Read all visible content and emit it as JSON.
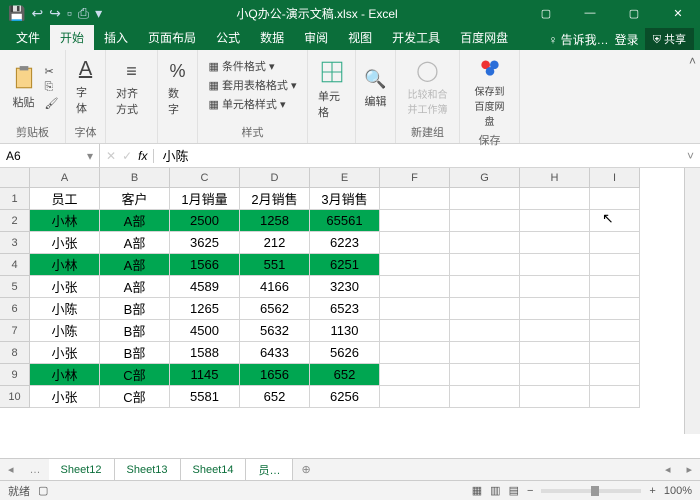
{
  "title": "小Q办公-演示文稿.xlsx - Excel",
  "tabs": [
    "文件",
    "开始",
    "插入",
    "页面布局",
    "公式",
    "数据",
    "审阅",
    "视图",
    "开发工具",
    "百度网盘"
  ],
  "active_tab": 1,
  "tell_me": "告诉我…",
  "login": "登录",
  "share": "共享",
  "ribbon": {
    "clipboard": {
      "paste": "粘贴",
      "label": "剪贴板"
    },
    "font": {
      "btn": "字体",
      "label": "字体"
    },
    "align": {
      "btn": "对齐方式",
      "label": ""
    },
    "number": {
      "btn": "数字",
      "label": ""
    },
    "styles": {
      "a": "条件格式",
      "b": "套用表格格式",
      "c": "单元格样式",
      "label": "样式"
    },
    "cells": {
      "btn": "单元格",
      "label": ""
    },
    "editing": {
      "btn": "编辑",
      "label": ""
    },
    "newgroup": {
      "btn": "比较和合并工作簿",
      "label": "新建组"
    },
    "save": {
      "btn": "保存到百度网盘",
      "label": "保存"
    }
  },
  "namebox": "A6",
  "fx": "fx",
  "formula_value": "小陈",
  "columns": [
    "A",
    "B",
    "C",
    "D",
    "E",
    "F",
    "G",
    "H",
    "I"
  ],
  "wclass": [
    "cw-a",
    "cw-b",
    "cw-c",
    "cw-d",
    "cw-e",
    "cw-f",
    "cw-g",
    "cw-h",
    "cw-i"
  ],
  "rownums": [
    "1",
    "2",
    "3",
    "4",
    "5",
    "6",
    "7",
    "8",
    "9",
    "10"
  ],
  "rows": [
    {
      "hl": false,
      "hdr": true,
      "cells": [
        "员工",
        "客户",
        "1月销量",
        "2月销售",
        "3月销售",
        "",
        "",
        "",
        ""
      ]
    },
    {
      "hl": true,
      "cells": [
        "小林",
        "A部",
        "2500",
        "1258",
        "65561",
        "",
        "",
        "",
        ""
      ]
    },
    {
      "hl": false,
      "cells": [
        "小张",
        "A部",
        "3625",
        "212",
        "6223",
        "",
        "",
        "",
        ""
      ]
    },
    {
      "hl": true,
      "cells": [
        "小林",
        "A部",
        "1566",
        "551",
        "6251",
        "",
        "",
        "",
        ""
      ]
    },
    {
      "hl": false,
      "cells": [
        "小张",
        "A部",
        "4589",
        "4166",
        "3230",
        "",
        "",
        "",
        ""
      ]
    },
    {
      "hl": false,
      "cells": [
        "小陈",
        "B部",
        "1265",
        "6562",
        "6523",
        "",
        "",
        "",
        ""
      ]
    },
    {
      "hl": false,
      "cells": [
        "小陈",
        "B部",
        "4500",
        "5632",
        "1130",
        "",
        "",
        "",
        ""
      ]
    },
    {
      "hl": false,
      "cells": [
        "小张",
        "B部",
        "1588",
        "6433",
        "5626",
        "",
        "",
        "",
        ""
      ]
    },
    {
      "hl": true,
      "cells": [
        "小林",
        "C部",
        "1145",
        "1656",
        "652",
        "",
        "",
        "",
        ""
      ]
    },
    {
      "hl": false,
      "cells": [
        "小张",
        "C部",
        "5581",
        "652",
        "6256",
        "",
        "",
        "",
        ""
      ]
    }
  ],
  "sheets": [
    "Sheet12",
    "Sheet13",
    "Sheet14"
  ],
  "sheet_extra": "员…",
  "status": {
    "ready": "就绪",
    "rec": "",
    "zoom": "100%"
  }
}
